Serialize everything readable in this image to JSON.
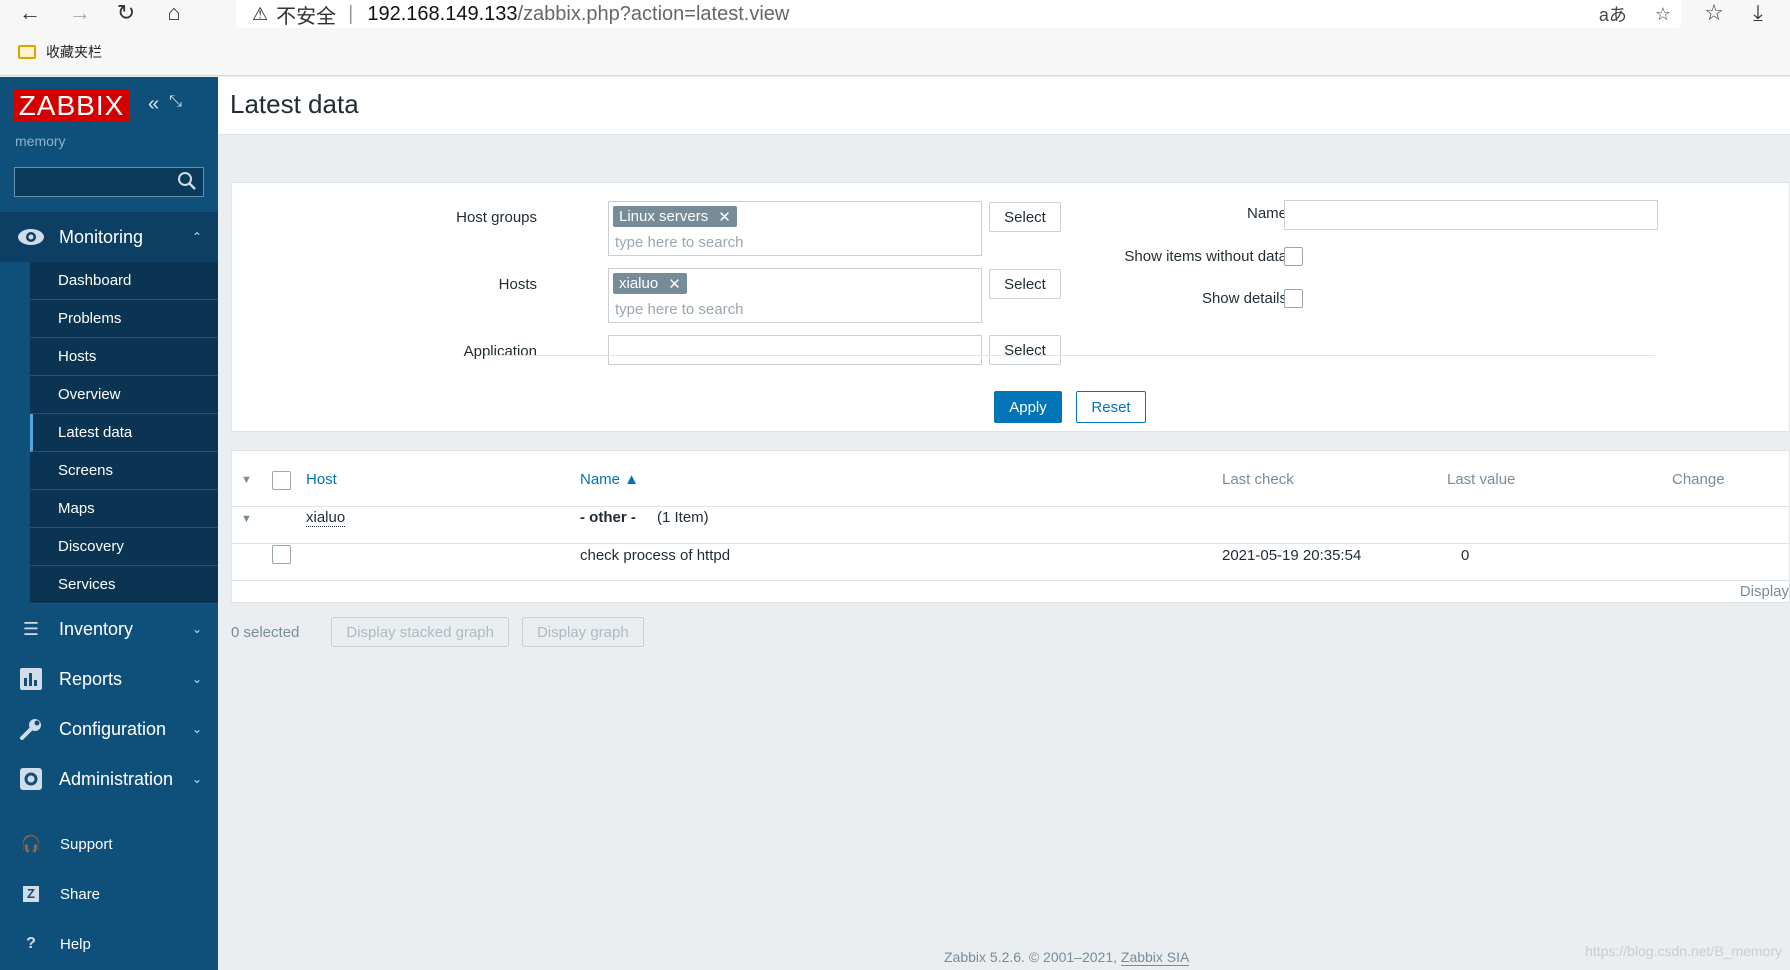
{
  "browser": {
    "insecure_label": "不安全",
    "separator": "|",
    "url_host": "192.168.149.133",
    "url_path": "/zabbix.php?action=latest.view",
    "bookmark_folder": "收藏夹栏",
    "translate_glyph": "aあ"
  },
  "sidebar": {
    "logo": "ZABBIX",
    "server_name": "memory",
    "monitoring": {
      "label": "Monitoring",
      "items": [
        {
          "label": "Dashboard"
        },
        {
          "label": "Problems"
        },
        {
          "label": "Hosts"
        },
        {
          "label": "Overview"
        },
        {
          "label": "Latest data",
          "active": true
        },
        {
          "label": "Screens"
        },
        {
          "label": "Maps"
        },
        {
          "label": "Discovery"
        },
        {
          "label": "Services"
        }
      ]
    },
    "sections": [
      {
        "label": "Inventory",
        "icon": "list-icon"
      },
      {
        "label": "Reports",
        "icon": "bar-chart-icon"
      },
      {
        "label": "Configuration",
        "icon": "wrench-icon"
      },
      {
        "label": "Administration",
        "icon": "gear-icon"
      }
    ],
    "bottom": [
      {
        "label": "Support",
        "icon": "headset-icon"
      },
      {
        "label": "Share",
        "icon": "share-icon"
      },
      {
        "label": "Help",
        "icon": "help-icon"
      }
    ]
  },
  "page": {
    "title": "Latest data"
  },
  "filter": {
    "host_groups_label": "Host groups",
    "host_groups_chip": "Linux servers",
    "hosts_label": "Hosts",
    "hosts_chip": "xialuo",
    "placeholder": "type here to search",
    "application_label": "Application",
    "select_label": "Select",
    "name_label": "Name",
    "show_without_data_label": "Show items without data",
    "show_details_label": "Show details",
    "apply_label": "Apply",
    "reset_label": "Reset"
  },
  "table": {
    "columns": {
      "host": "Host",
      "name": "Name ▲",
      "last_check": "Last check",
      "last_value": "Last value",
      "change": "Change"
    },
    "group_host": "xialuo",
    "group_app": "- other -",
    "group_count": "(1 Item)",
    "item_name": "check process of httpd",
    "item_last_check": "2021-05-19 20:35:54",
    "item_last_value": "0",
    "display_link": "Display"
  },
  "actions": {
    "selected_count": "0 selected",
    "stacked_graph": "Display stacked graph",
    "graph": "Display graph"
  },
  "footer": {
    "copyright": "Zabbix 5.2.6. © 2001–2021,",
    "company": "Zabbix SIA",
    "watermark": "https://blog.csdn.net/B_memory"
  },
  "colors": {
    "sidebar_bg": "#0f507b",
    "logo_red": "#d40000",
    "accent_blue": "#0275b8"
  }
}
